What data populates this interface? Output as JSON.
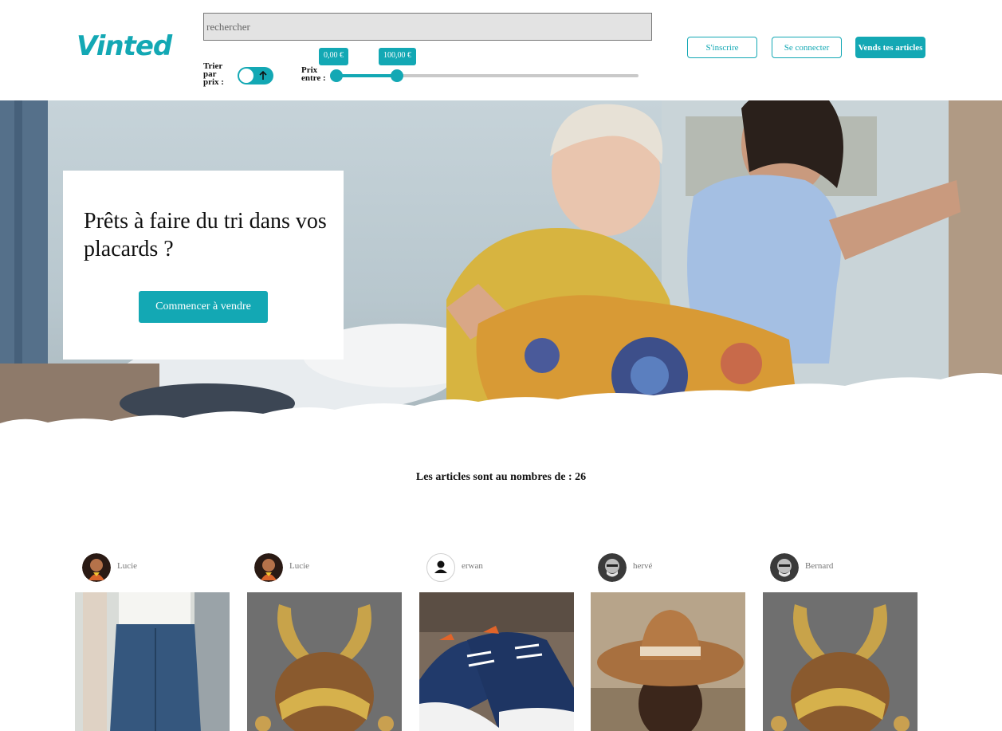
{
  "header": {
    "logo": "Vinted",
    "search_placeholder": "rechercher",
    "sort_label": "Trier par prix :",
    "sort_ascending": true,
    "price_label": "Prix entre :",
    "price_min": "0,00 €",
    "price_max": "100,00 €",
    "signup_label": "S'inscrire",
    "login_label": "Se connecter",
    "sell_label": "Vends tes articles"
  },
  "hero": {
    "title": "Prêts à faire du tri dans vos placards ?",
    "cta_label": "Commencer à vendre"
  },
  "articles_count_text": "Les articles sont au nombres de : 26",
  "articles": [
    {
      "seller": "Lucie",
      "avatar": "photo-avatar",
      "product": "denim-skirt"
    },
    {
      "seller": "Lucie",
      "avatar": "photo-avatar",
      "product": "samurai-helmet"
    },
    {
      "seller": "erwan",
      "avatar": "default-user-icon",
      "product": "sneakers"
    },
    {
      "seller": "hervé",
      "avatar": "photo-avatar",
      "product": "hat"
    },
    {
      "seller": "Bernard",
      "avatar": "photo-avatar",
      "product": "samurai-helmet"
    }
  ],
  "colors": {
    "accent": "#13a8b4"
  }
}
